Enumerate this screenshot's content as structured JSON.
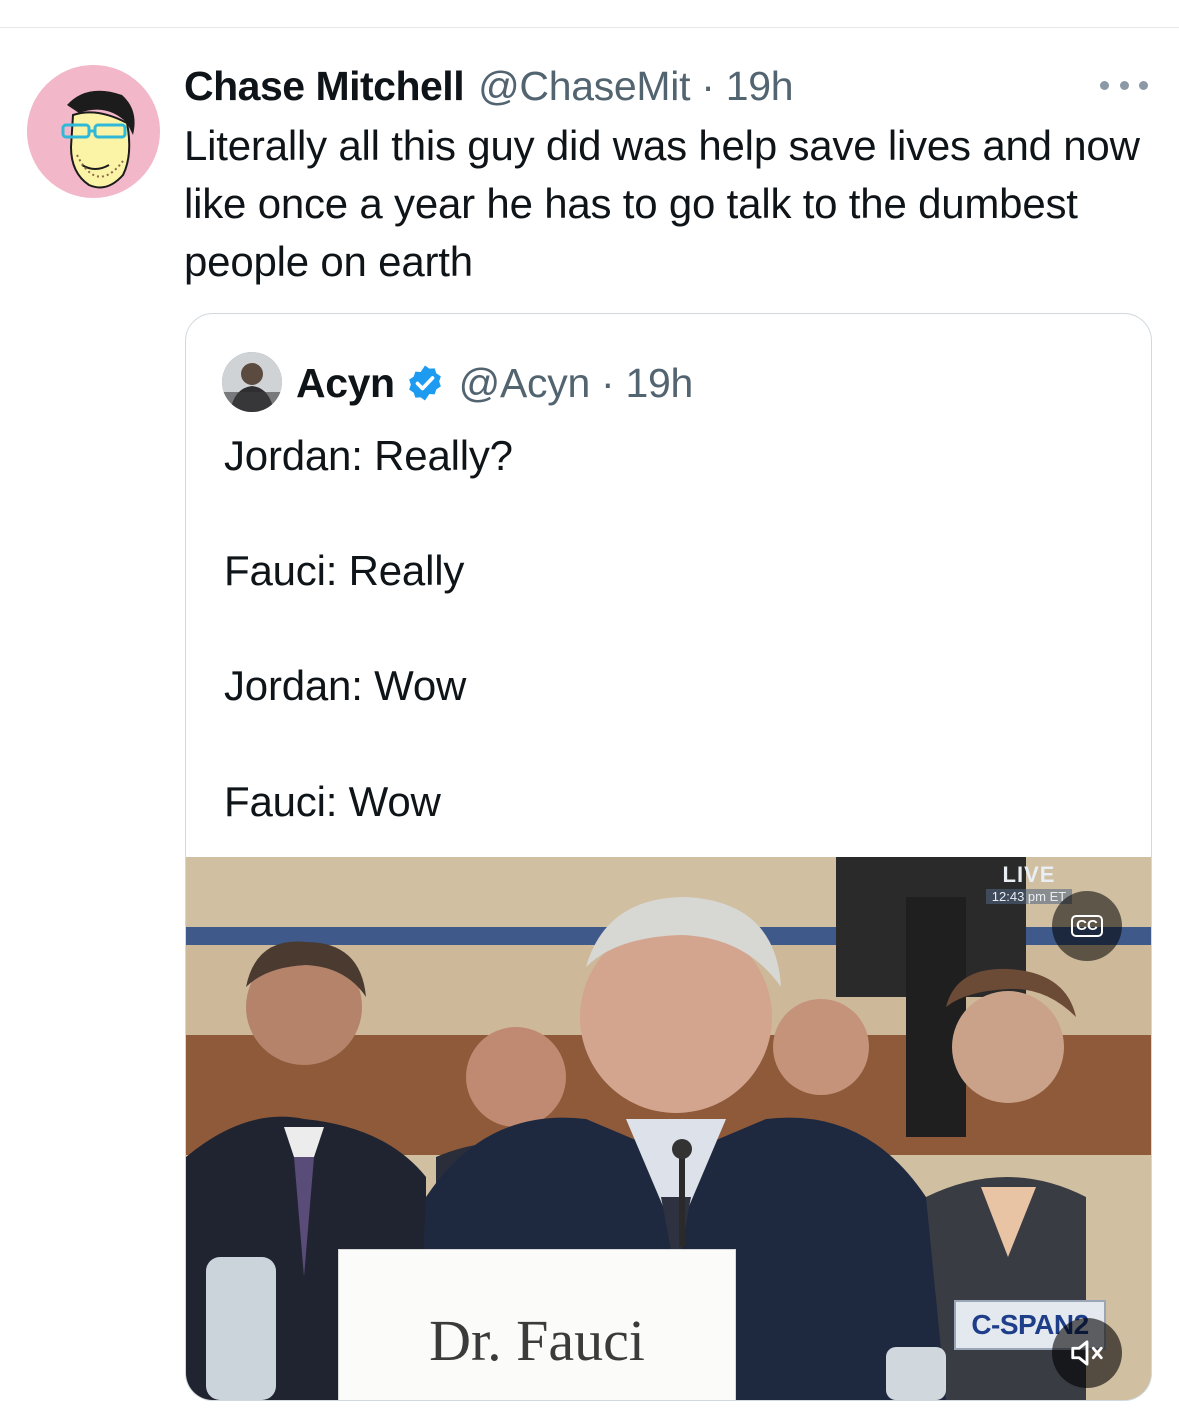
{
  "tweet": {
    "author_name": "Chase Mitchell",
    "handle_time": "@ChaseMit · 19h",
    "text": "Literally all this guy did was help save lives and now like once a year he has to go talk to the dumbest people on earth",
    "avatar_icon": "cartoon-face-avatar",
    "more_icon": "more-horizontal-icon"
  },
  "quote": {
    "author_name": "Acyn",
    "handle_time": "@Acyn · 19h",
    "verified_icon": "verified-badge-icon",
    "lines": [
      "Jordan: Really?",
      "Fauci: Really",
      "Jordan: Wow",
      "Fauci: Wow"
    ],
    "media": {
      "placard": "Dr. Fauci",
      "live_label": "LIVE",
      "live_time": "12:43 pm ET",
      "cc_label": "CC",
      "network_logo": "C-SPAN2",
      "mute_icon": "speaker-muted-icon"
    }
  },
  "colors": {
    "text": "#0f1419",
    "secondary": "#536471",
    "border": "#cfd9de",
    "verified": "#1d9bf0",
    "avatar_bg": "#f2b8c9"
  }
}
